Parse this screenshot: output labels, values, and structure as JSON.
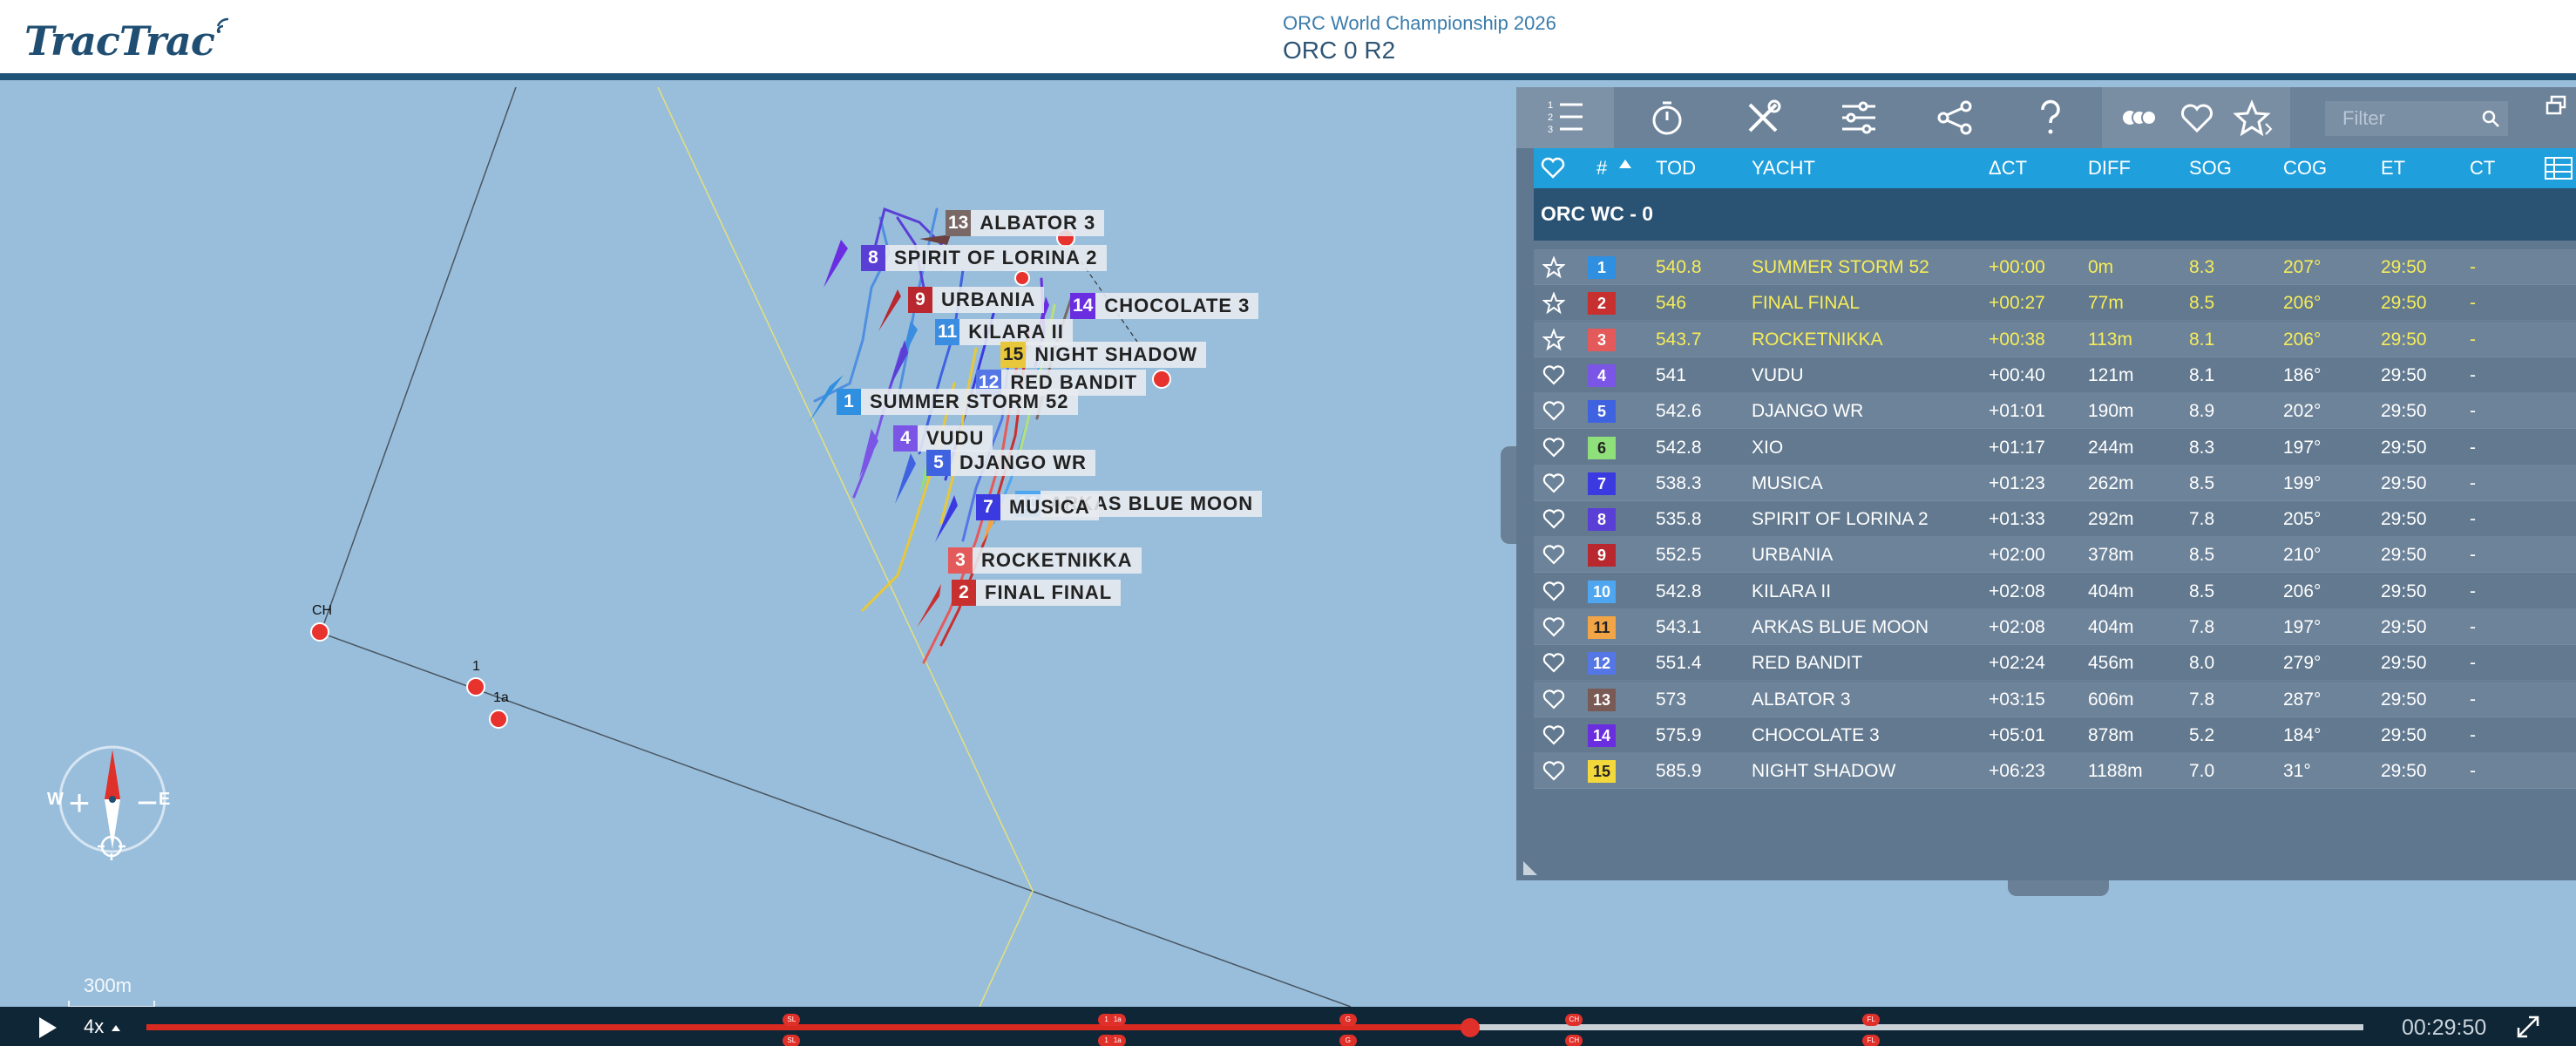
{
  "header": {
    "logo": "TracTrac",
    "event": "ORC World Championship 2026",
    "race": "ORC 0 R2"
  },
  "map": {
    "marks": [
      "CH",
      "1",
      "1a"
    ],
    "scale": "300m",
    "compass": {
      "west": "W",
      "east": "E"
    },
    "zoom_in": "+",
    "zoom_out": "−"
  },
  "boat_labels": [
    {
      "num": "13",
      "name": "ALBATOR 3",
      "color": "#7a6866"
    },
    {
      "num": "8",
      "name": "SPIRIT OF LORINA 2",
      "color": "#5a3fd6"
    },
    {
      "num": "9",
      "name": "URBANIA",
      "color": "#b8282e"
    },
    {
      "num": "14",
      "name": "CHOCOLATE 3",
      "color": "#6a2ee0"
    },
    {
      "num": "11",
      "name": "KILARA II",
      "color": "#3a8de0"
    },
    {
      "num": "15",
      "name": "NIGHT SHADOW",
      "color": "#e8c83a"
    },
    {
      "num": "12",
      "name": "RED BANDIT",
      "color": "#5577e6"
    },
    {
      "num": "1",
      "name": "SUMMER STORM 52",
      "color": "#2f8fe0"
    },
    {
      "num": "4",
      "name": "VUDU",
      "color": "#7a55e6"
    },
    {
      "num": "5",
      "name": "DJANGO WR",
      "color": "#3f63e0"
    },
    {
      "num": "7",
      "name": "MUSICA",
      "color": "#3a3ae0"
    },
    {
      "num": "10",
      "name": "ARKAS BLUE MOON",
      "color": "#4ea6f0"
    },
    {
      "num": "3",
      "name": "ROCKETNIKKA",
      "color": "#e45a5a"
    },
    {
      "num": "2",
      "name": "FINAL FINAL",
      "color": "#c8302f"
    }
  ],
  "toolbar": {
    "filter_placeholder": "Filter"
  },
  "table": {
    "headers": {
      "num": "#",
      "tod": "TOD",
      "yacht": "YACHT",
      "dct": "ΔCT",
      "diff": "DIFF",
      "sog": "SOG",
      "cog": "COG",
      "et": "ET",
      "ct": "CT"
    },
    "group": "ORC WC - 0",
    "rows": [
      {
        "pos": "1",
        "color": "#2f8fe0",
        "tod": "540.8",
        "yacht": "SUMMER STORM 52",
        "dct": "+00:00",
        "diff": "0m",
        "sog": "8.3",
        "cog": "207°",
        "et": "29:50",
        "ct": "-",
        "top": true
      },
      {
        "pos": "2",
        "color": "#c8302f",
        "tod": "546",
        "yacht": "FINAL FINAL",
        "dct": "+00:27",
        "diff": "77m",
        "sog": "8.5",
        "cog": "206°",
        "et": "29:50",
        "ct": "-",
        "top": true
      },
      {
        "pos": "3",
        "color": "#e45a5a",
        "tod": "543.7",
        "yacht": "ROCKETNIKKA",
        "dct": "+00:38",
        "diff": "113m",
        "sog": "8.1",
        "cog": "206°",
        "et": "29:50",
        "ct": "-",
        "top": true
      },
      {
        "pos": "4",
        "color": "#7a55e6",
        "tod": "541",
        "yacht": "VUDU",
        "dct": "+00:40",
        "diff": "121m",
        "sog": "8.1",
        "cog": "186°",
        "et": "29:50",
        "ct": "-",
        "top": false
      },
      {
        "pos": "5",
        "color": "#3f63e0",
        "tod": "542.6",
        "yacht": "DJANGO WR",
        "dct": "+01:01",
        "diff": "190m",
        "sog": "8.9",
        "cog": "202°",
        "et": "29:50",
        "ct": "-",
        "top": false
      },
      {
        "pos": "6",
        "color": "#8fe07a",
        "tod": "542.8",
        "yacht": "XIO",
        "dct": "+01:17",
        "diff": "244m",
        "sog": "8.3",
        "cog": "197°",
        "et": "29:50",
        "ct": "-",
        "top": false
      },
      {
        "pos": "7",
        "color": "#3a3ae0",
        "tod": "538.3",
        "yacht": "MUSICA",
        "dct": "+01:23",
        "diff": "262m",
        "sog": "8.5",
        "cog": "199°",
        "et": "29:50",
        "ct": "-",
        "top": false
      },
      {
        "pos": "8",
        "color": "#5a3fd6",
        "tod": "535.8",
        "yacht": "SPIRIT OF LORINA 2",
        "dct": "+01:33",
        "diff": "292m",
        "sog": "7.8",
        "cog": "205°",
        "et": "29:50",
        "ct": "-",
        "top": false
      },
      {
        "pos": "9",
        "color": "#b8282e",
        "tod": "552.5",
        "yacht": "URBANIA",
        "dct": "+02:00",
        "diff": "378m",
        "sog": "8.5",
        "cog": "210°",
        "et": "29:50",
        "ct": "-",
        "top": false
      },
      {
        "pos": "10",
        "color": "#4ea6f0",
        "tod": "542.8",
        "yacht": "KILARA II",
        "dct": "+02:08",
        "diff": "404m",
        "sog": "8.5",
        "cog": "206°",
        "et": "29:50",
        "ct": "-",
        "top": false
      },
      {
        "pos": "11",
        "color": "#f2a546",
        "tod": "543.1",
        "yacht": "ARKAS BLUE MOON",
        "dct": "+02:08",
        "diff": "404m",
        "sog": "7.8",
        "cog": "197°",
        "et": "29:50",
        "ct": "-",
        "top": false
      },
      {
        "pos": "12",
        "color": "#5577e6",
        "tod": "551.4",
        "yacht": "RED BANDIT",
        "dct": "+02:24",
        "diff": "456m",
        "sog": "8.0",
        "cog": "279°",
        "et": "29:50",
        "ct": "-",
        "top": false
      },
      {
        "pos": "13",
        "color": "#7a5a55",
        "tod": "573",
        "yacht": "ALBATOR 3",
        "dct": "+03:15",
        "diff": "606m",
        "sog": "7.8",
        "cog": "287°",
        "et": "29:50",
        "ct": "-",
        "top": false
      },
      {
        "pos": "14",
        "color": "#6a2ee0",
        "tod": "575.9",
        "yacht": "CHOCOLATE 3",
        "dct": "+05:01",
        "diff": "878m",
        "sog": "5.2",
        "cog": "184°",
        "et": "29:50",
        "ct": "-",
        "top": false
      },
      {
        "pos": "15",
        "color": "#f2d83a",
        "tod": "585.9",
        "yacht": "NIGHT SHADOW",
        "dct": "+06:23",
        "diff": "1188m",
        "sog": "7.0",
        "cog": "31°",
        "et": "29:50",
        "ct": "-",
        "top": false
      }
    ]
  },
  "timeline": {
    "speed": "4x",
    "time": "00:29:50",
    "progress": 0.597,
    "markers": [
      {
        "label": "SL",
        "pos": 0.291
      },
      {
        "label": "1",
        "pos": 0.433
      },
      {
        "label": "1a",
        "pos": 0.438
      },
      {
        "label": "G",
        "pos": 0.542
      },
      {
        "label": "CH",
        "pos": 0.644
      },
      {
        "label": "FL",
        "pos": 0.778
      }
    ]
  }
}
